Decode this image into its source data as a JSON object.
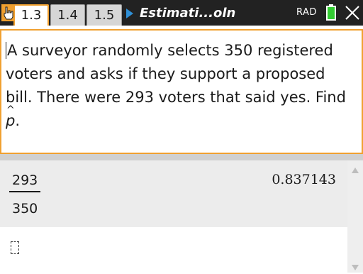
{
  "titlebar": {
    "tool_icon": "hand-pointer-icon",
    "tabs": [
      {
        "label": "1.3",
        "active": true
      },
      {
        "label": "1.4",
        "active": false
      },
      {
        "label": "1.5",
        "active": false
      }
    ],
    "play_icon": "play-triangle-icon",
    "doc_title": "Estimati...oln",
    "mode": "RAD",
    "battery_icon": "battery-icon",
    "close_icon": "close-icon"
  },
  "notes": {
    "line_1": "A surveyor randomly selects 350 registered",
    "line_2": "voters and asks if they support a proposed",
    "line_3": "bill. There were 293 voters that said yes. Find",
    "symbol": "p",
    "end": "."
  },
  "calculator": {
    "entry": {
      "numerator": "293",
      "denominator": "350",
      "result": "0.837143"
    }
  },
  "colors": {
    "accent": "#f0a030",
    "titlebar_bg": "#222222",
    "battery": "#33cc33",
    "play": "#2f8fd6"
  }
}
